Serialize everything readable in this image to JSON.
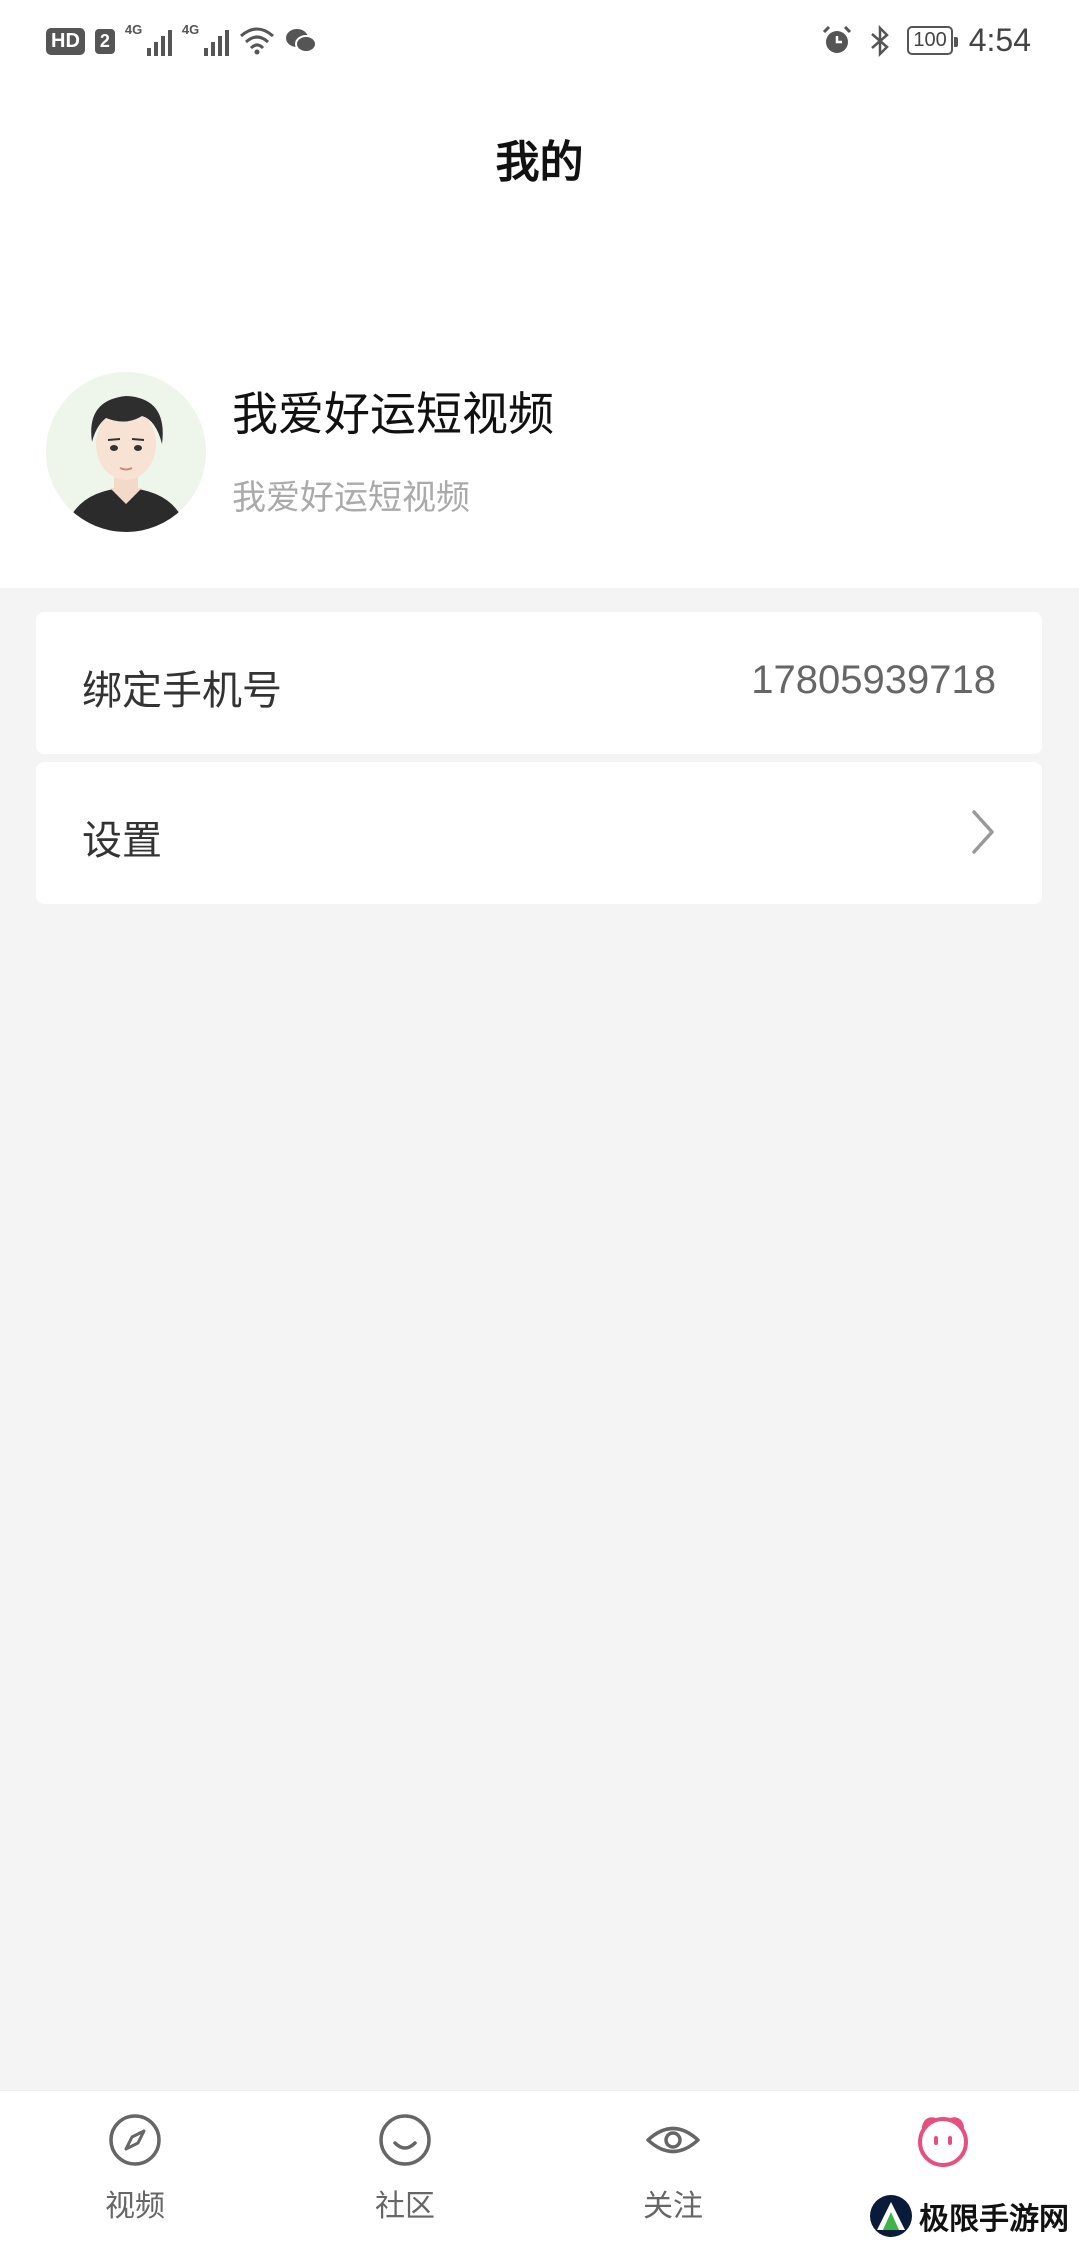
{
  "status_bar": {
    "hd_badge": "HD",
    "sim_badge": "2",
    "net1": "4G",
    "net2": "4G",
    "battery": "100",
    "time": "4:54"
  },
  "page": {
    "title": "我的"
  },
  "profile": {
    "name": "我爱好运短视频",
    "subtitle": "我爱好运短视频"
  },
  "rows": {
    "phone_label": "绑定手机号",
    "phone_value": "17805939718",
    "settings_label": "设置"
  },
  "tabs": [
    {
      "label": "视频",
      "icon": "compass-icon"
    },
    {
      "label": "社区",
      "icon": "smile-icon"
    },
    {
      "label": "关注",
      "icon": "eye-icon"
    },
    {
      "label": "",
      "icon": "mine-face-icon",
      "active": true
    }
  ],
  "colors": {
    "active_tab": "#e5507f",
    "inactive_tab": "#666666"
  },
  "watermark": {
    "text": "极限手游网"
  }
}
